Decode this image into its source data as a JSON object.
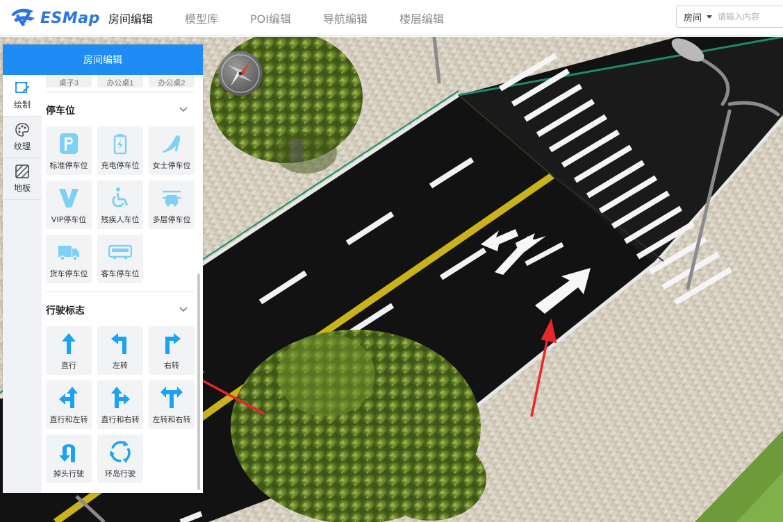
{
  "app": {
    "logo_text": "ESMap"
  },
  "nav": [
    {
      "label": "房间编辑",
      "active": true
    },
    {
      "label": "模型库",
      "active": false
    },
    {
      "label": "POI编辑",
      "active": false
    },
    {
      "label": "导航编辑",
      "active": false
    },
    {
      "label": "楼层编辑",
      "active": false
    }
  ],
  "search": {
    "selected": "房间",
    "placeholder": "请输入内容"
  },
  "panel": {
    "title": "房间编辑",
    "side_tabs": [
      {
        "label": "绘制",
        "icon": "draw-icon"
      },
      {
        "label": "纹理",
        "icon": "palette-icon"
      },
      {
        "label": "地板",
        "icon": "floor-icon"
      }
    ],
    "prev_row": [
      "桌子3",
      "办公桌1",
      "办公桌2"
    ],
    "sections": [
      {
        "title": "停车位",
        "items": [
          {
            "label": "标准停车位",
            "icon": "parking-p-icon"
          },
          {
            "label": "充电停车位",
            "icon": "charging-parking-icon"
          },
          {
            "label": "女士停车位",
            "icon": "women-parking-icon"
          },
          {
            "label": "VIP停车位",
            "icon": "vip-parking-icon"
          },
          {
            "label": "残疾人车位",
            "icon": "wheelchair-parking-icon"
          },
          {
            "label": "多层停车位",
            "icon": "multilevel-parking-icon"
          },
          {
            "label": "货车停车位",
            "icon": "truck-parking-icon"
          },
          {
            "label": "客车停车位",
            "icon": "bus-parking-icon"
          }
        ]
      },
      {
        "title": "行驶标志",
        "items": [
          {
            "label": "直行",
            "icon": "arrow-straight-icon"
          },
          {
            "label": "左转",
            "icon": "arrow-left-turn-icon"
          },
          {
            "label": "右转",
            "icon": "arrow-right-turn-icon"
          },
          {
            "label": "直行和左转",
            "icon": "arrow-straight-left-icon"
          },
          {
            "label": "直行和右转",
            "icon": "arrow-straight-right-icon"
          },
          {
            "label": "左转和右转",
            "icon": "arrow-left-right-icon"
          },
          {
            "label": "掉头行驶",
            "icon": "arrow-u-turn-icon"
          },
          {
            "label": "环岛行驶",
            "icon": "roundabout-icon"
          }
        ]
      }
    ]
  },
  "colors": {
    "accent": "#1f8bf5",
    "icon": "#1aa3f5",
    "icon_light": "#7fd0f7",
    "annotation_arrow": "#e8262b"
  }
}
